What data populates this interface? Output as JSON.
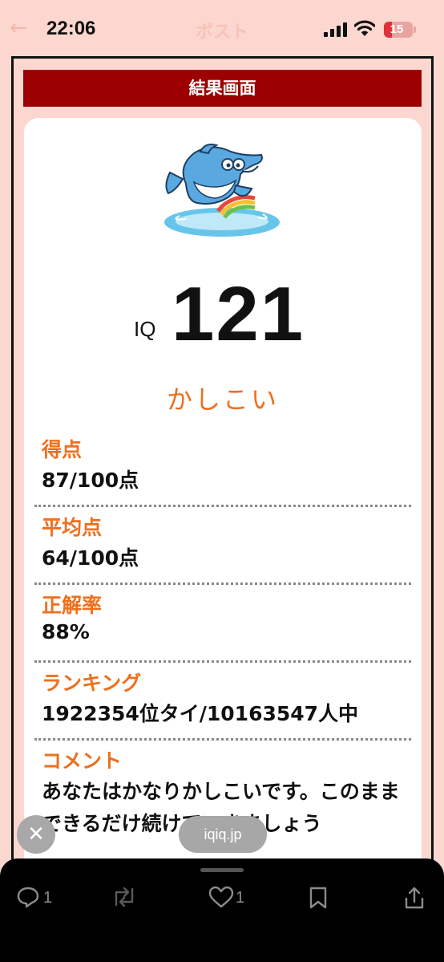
{
  "status": {
    "time": "22:06",
    "header_title": "ポスト",
    "battery": "15"
  },
  "page": {
    "title": "結果画面",
    "iq_label": "IQ",
    "iq_value": "121",
    "rank_word": "かしこい"
  },
  "results": [
    {
      "label": "得点",
      "value": "87/100点"
    },
    {
      "label": "平均点",
      "value": "64/100点"
    },
    {
      "label": "正解率",
      "value": "88%"
    },
    {
      "label": "ランキング",
      "value": "1922354位タイ/10163547人中"
    }
  ],
  "comment": {
    "label": "コメント",
    "text": "あなたはかなりかしこいです。このままできるだけ続けていきましょう"
  },
  "browser": {
    "url": "iqiq.jp",
    "close": "✕"
  },
  "actions": {
    "reply_count": "1",
    "like_count": "1"
  },
  "colors": {
    "background": "#fcd7cf",
    "title_bar": "#9c0000",
    "accent": "#ee6f1e"
  }
}
